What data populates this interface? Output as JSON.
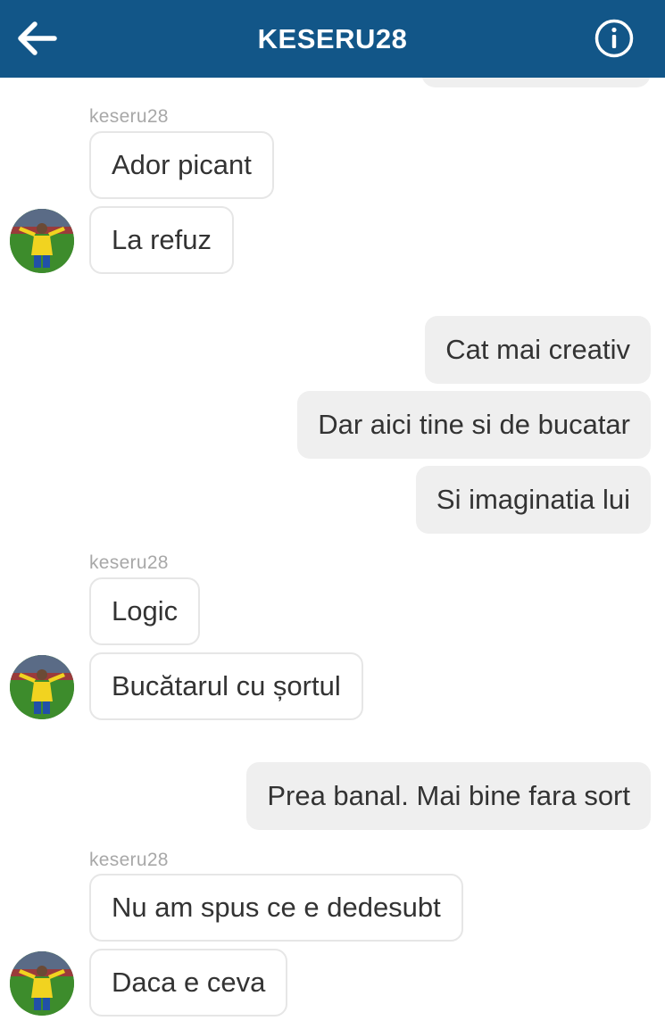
{
  "header": {
    "title": "KESERU28",
    "background": "#125688",
    "back_icon": "arrow-left-icon",
    "info_icon": "info-circle-icon"
  },
  "messages": {
    "group1": {
      "sender": "keseru28",
      "m1": "Ador picant",
      "m2": "La refuz"
    },
    "group2": {
      "m1": "Cat mai creativ",
      "m2": "Dar aici tine si de bucatar",
      "m3": "Si imaginatia lui"
    },
    "group3": {
      "sender": "keseru28",
      "m1": "Logic",
      "m2": "Bucătarul cu șortul"
    },
    "group4": {
      "m1": "Prea banal. Mai bine fara sort"
    },
    "group5": {
      "sender": "keseru28",
      "m1": "Nu am spus ce e dedesubt",
      "m2": "Daca e ceva"
    }
  },
  "colors": {
    "outgoing_bubble": "#efefef",
    "incoming_border": "#e6e6e6",
    "sender_label": "#a8a8a8",
    "text": "#333333"
  }
}
